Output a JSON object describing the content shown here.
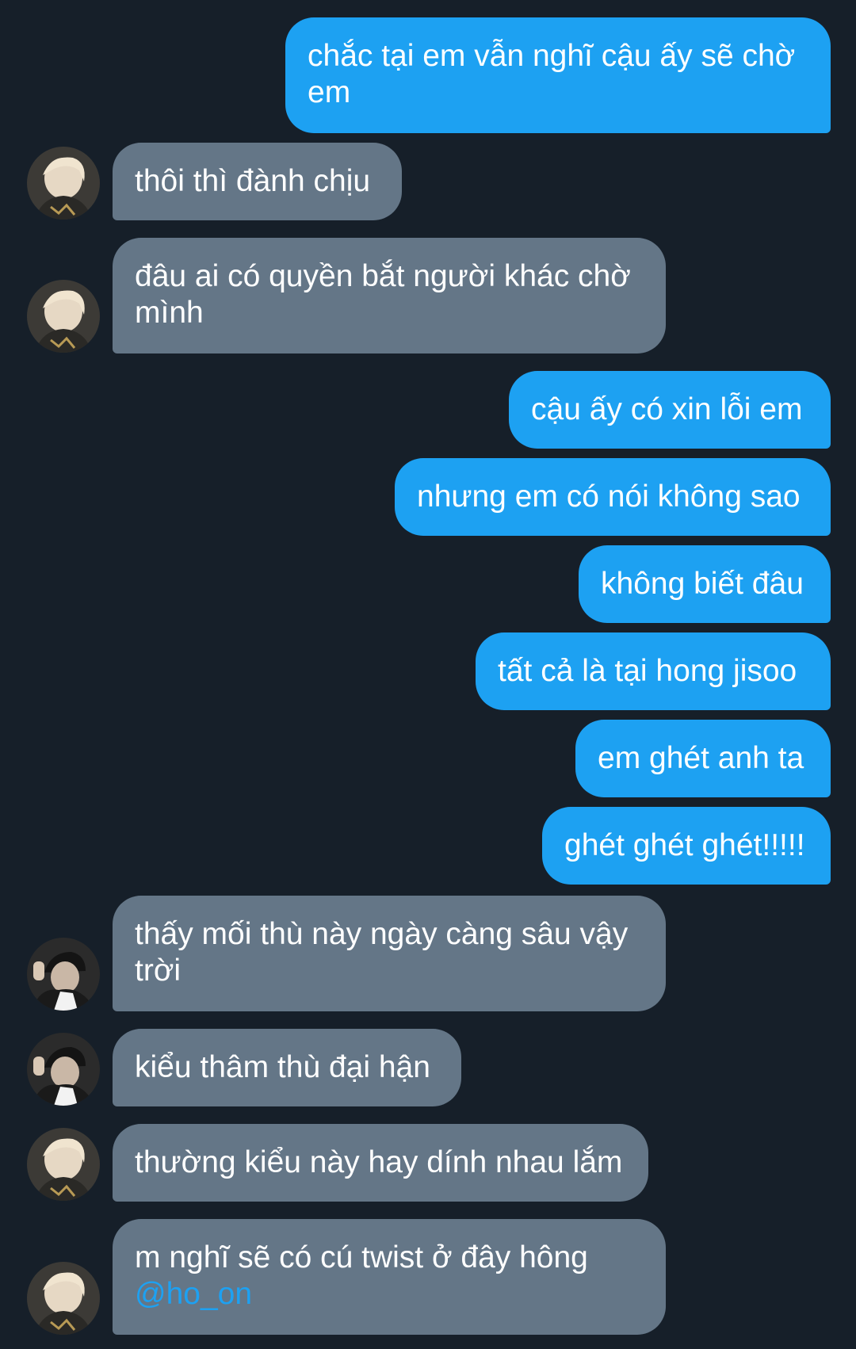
{
  "thread": {
    "messages": [
      {
        "side": "out",
        "text": "chắc tại em vẫn nghĩ cậu ấy sẽ chờ em"
      },
      {
        "side": "in",
        "avatar": "blonde-avatar",
        "text": "thôi thì đành chịu"
      },
      {
        "side": "in",
        "avatar": "blonde-avatar",
        "text": "đâu ai có quyền bắt người khác chờ mình"
      },
      {
        "side": "out",
        "text": "cậu ấy có xin lỗi em"
      },
      {
        "side": "out",
        "text": "nhưng em có nói không sao"
      },
      {
        "side": "out",
        "text": "không biết đâu"
      },
      {
        "side": "out",
        "text": "tất cả là tại hong jisoo"
      },
      {
        "side": "out",
        "text": "em ghét anh ta"
      },
      {
        "side": "out",
        "text": "ghét ghét ghét!!!!!"
      },
      {
        "side": "in",
        "avatar": "cap-avatar",
        "text": "thấy mối thù này ngày càng sâu vậy trời"
      },
      {
        "side": "in",
        "avatar": "cap-avatar",
        "text": "kiểu thâm thù đại hận"
      },
      {
        "side": "in",
        "avatar": "blonde-avatar",
        "text": "thường kiểu này hay dính nhau lắm"
      },
      {
        "side": "in",
        "avatar": "blonde-avatar",
        "text": "m nghĩ sẽ có cú twist ở đây hông",
        "mention": "@ho_on"
      }
    ]
  },
  "colors": {
    "background": "#161f29",
    "outgoing_bubble": "#1da1f2",
    "incoming_bubble": "#647687",
    "mention": "#1da1f2"
  }
}
